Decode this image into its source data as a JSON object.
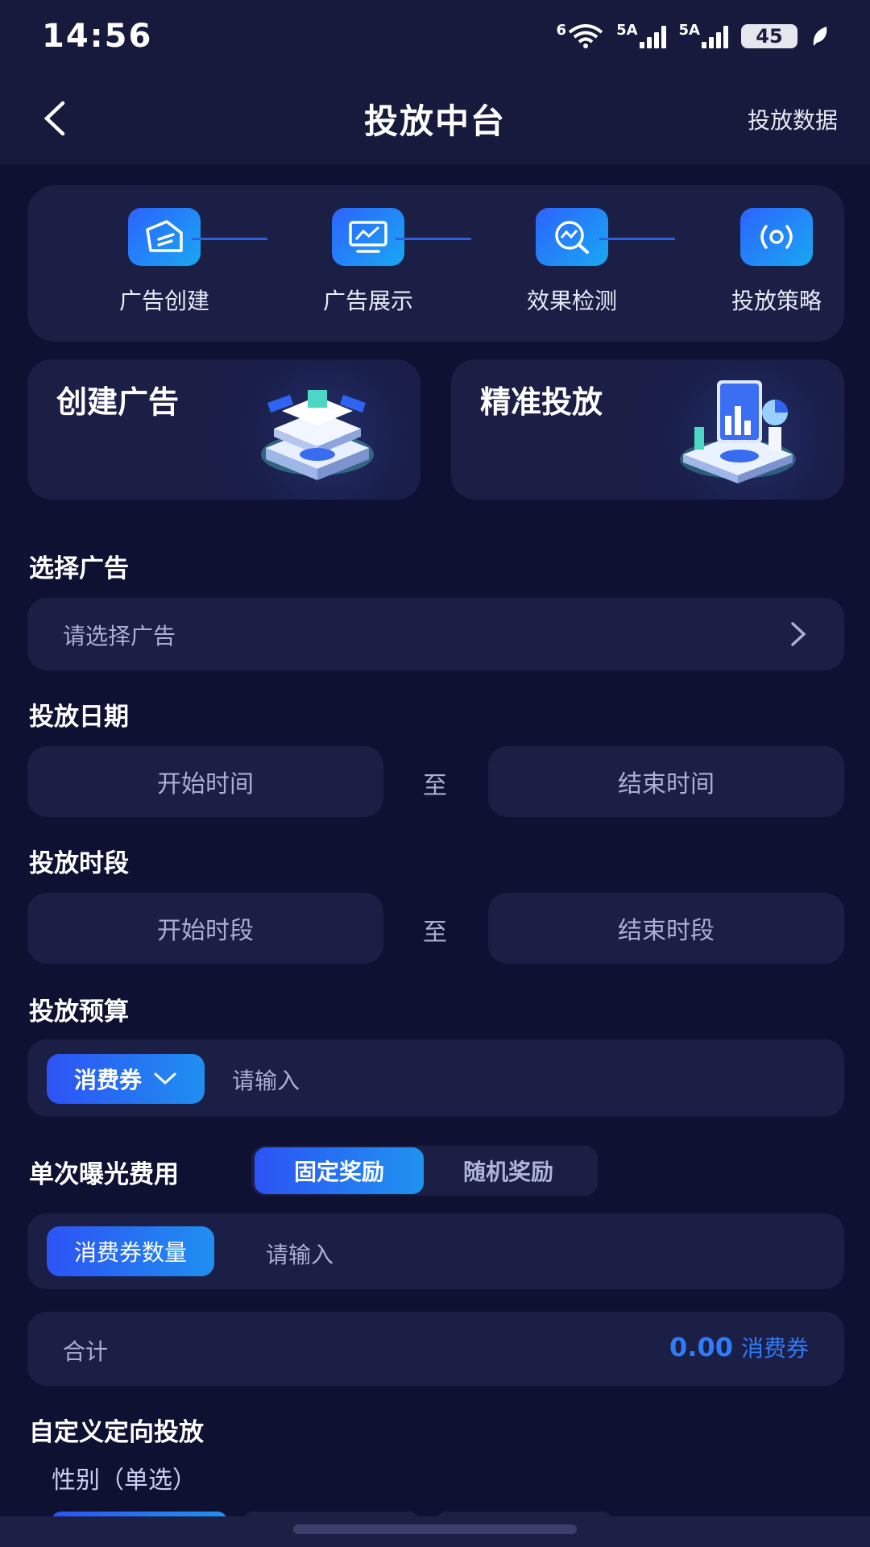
{
  "status_bar": {
    "time": "14:56",
    "wifi_badge": "6",
    "sim1": "5A",
    "sim2": "5A",
    "battery": "45"
  },
  "nav": {
    "title": "投放中台",
    "right_link": "投放数据"
  },
  "steps": [
    {
      "label": "广告创建",
      "icon": "ad-create-icon"
    },
    {
      "label": "广告展示",
      "icon": "monitor-chart-icon"
    },
    {
      "label": "效果检测",
      "icon": "search-trend-icon"
    },
    {
      "label": "投放策略",
      "icon": "broadcast-icon"
    }
  ],
  "features": {
    "create": "创建广告",
    "precise": "精准投放"
  },
  "select_ad": {
    "title": "选择广告",
    "placeholder": "请选择广告"
  },
  "date": {
    "title": "投放日期",
    "start": "开始时间",
    "to": "至",
    "end": "结束时间"
  },
  "period": {
    "title": "投放时段",
    "start": "开始时段",
    "to": "至",
    "end": "结束时段"
  },
  "budget": {
    "title": "投放预算",
    "type": "消费券",
    "placeholder": "请输入"
  },
  "exposure": {
    "title": "单次曝光费用",
    "tabs": [
      "固定奖励",
      "随机奖励"
    ],
    "field_label": "消费券数量",
    "placeholder": "请输入"
  },
  "total": {
    "label": "合计",
    "value": "0.00",
    "unit": "消费券"
  },
  "targeting": {
    "title": "自定义定向投放",
    "gender_label": "性别（单选）"
  },
  "colors": {
    "background": "#0f1133",
    "card": "#1b1e45",
    "accent": "#2f7cf8"
  }
}
